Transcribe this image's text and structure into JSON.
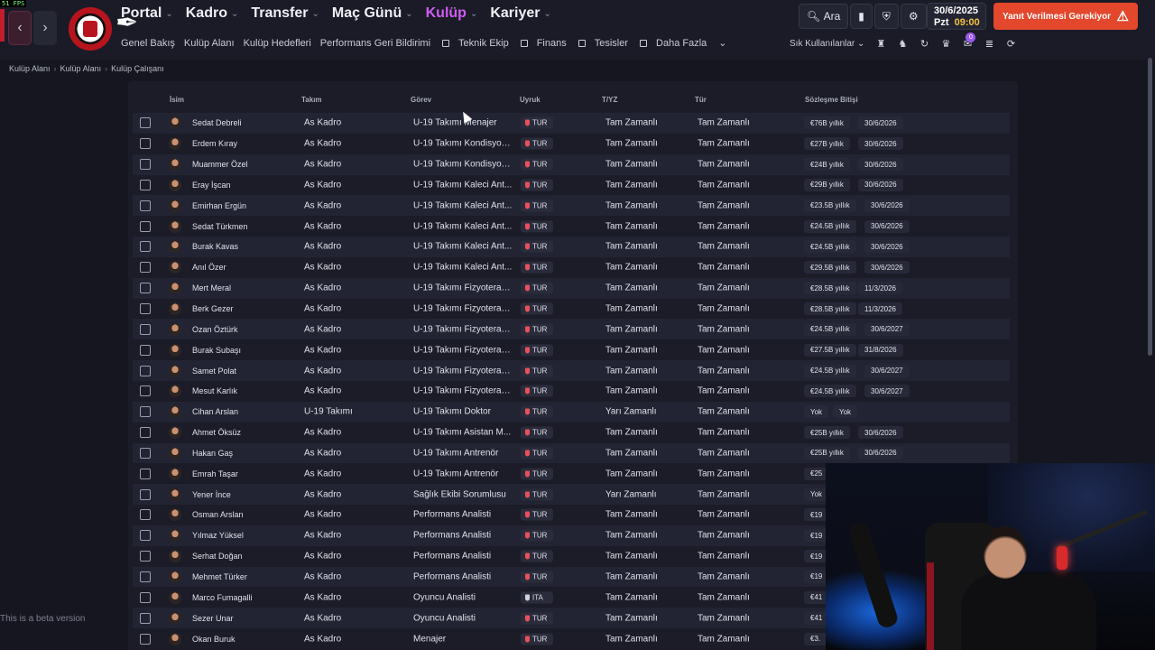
{
  "fps": "51 FPS",
  "nav": {
    "back": "‹",
    "forward": "›"
  },
  "menu": [
    {
      "label": "Portal"
    },
    {
      "label": "Kadro"
    },
    {
      "label": "Transfer"
    },
    {
      "label": "Maç Günü"
    },
    {
      "label": "Kulüp"
    },
    {
      "label": "Kariyer"
    }
  ],
  "submenu": [
    "Genel Bakış",
    "Kulüp Alanı",
    "Kulüp Hedefleri",
    "Performans Geri Bildirimi",
    "Teknik Ekip",
    "Finans",
    "Tesisler",
    "Daha Fazla"
  ],
  "search_label": "Ara",
  "date": "30/6/2025",
  "day": "Pzt",
  "time": "09:00",
  "alert_label": "Yanıt Verilmesi Gerekiyor",
  "shortcuts_label": "Sık Kullanılanlar",
  "notification_count": "0",
  "breadcrumb": [
    "Kulüp Alanı",
    "Kulüp Alanı",
    "Kulüp Çalışanı"
  ],
  "columns": [
    "İsim",
    "Takım",
    "Görev",
    "Uyruk",
    "T/YZ",
    "Tür",
    "Sözleşme Bitişi"
  ],
  "rows": [
    {
      "name": "Sedat Debreli",
      "team": "As Kadro",
      "role": "U-19 Takımı Menajer",
      "nat": "TUR",
      "ft": "Tam Zamanlı",
      "type": "Tam Zamanlı",
      "salary": "€76B yıllık",
      "end": "30/6/2026"
    },
    {
      "name": "Erdem Kıray",
      "team": "As Kadro",
      "role": "U-19 Takımı Kondisyon...",
      "nat": "TUR",
      "ft": "Tam Zamanlı",
      "type": "Tam Zamanlı",
      "salary": "€27B yıllık",
      "end": "30/6/2026"
    },
    {
      "name": "Muammer Özel",
      "team": "As Kadro",
      "role": "U-19 Takımı Kondisyon...",
      "nat": "TUR",
      "ft": "Tam Zamanlı",
      "type": "Tam Zamanlı",
      "salary": "€24B yıllık",
      "end": "30/6/2026"
    },
    {
      "name": "Eray İşcan",
      "team": "As Kadro",
      "role": "U-19 Takımı Kaleci Ant...",
      "nat": "TUR",
      "ft": "Tam Zamanlı",
      "type": "Tam Zamanlı",
      "salary": "€29B yıllık",
      "end": "30/6/2026"
    },
    {
      "name": "Emirhan Ergün",
      "team": "As Kadro",
      "role": "U-19 Takımı Kaleci Ant...",
      "nat": "TUR",
      "ft": "Tam Zamanlı",
      "type": "Tam Zamanlı",
      "salary": "€23.5B yıllık",
      "end": "30/6/2026"
    },
    {
      "name": "Sedat Türkmen",
      "team": "As Kadro",
      "role": "U-19 Takımı Kaleci Ant...",
      "nat": "TUR",
      "ft": "Tam Zamanlı",
      "type": "Tam Zamanlı",
      "salary": "€24.5B yıllık",
      "end": "30/6/2026"
    },
    {
      "name": "Burak Kavas",
      "team": "As Kadro",
      "role": "U-19 Takımı Kaleci Ant...",
      "nat": "TUR",
      "ft": "Tam Zamanlı",
      "type": "Tam Zamanlı",
      "salary": "€24.5B yıllık",
      "end": "30/6/2026"
    },
    {
      "name": "Anıl Özer",
      "team": "As Kadro",
      "role": "U-19 Takımı Kaleci Ant...",
      "nat": "TUR",
      "ft": "Tam Zamanlı",
      "type": "Tam Zamanlı",
      "salary": "€29.5B yıllık",
      "end": "30/6/2026"
    },
    {
      "name": "Mert Meral",
      "team": "As Kadro",
      "role": "U-19 Takımı Fizyoterap...",
      "nat": "TUR",
      "ft": "Tam Zamanlı",
      "type": "Tam Zamanlı",
      "salary": "€28.5B yıllık",
      "end": "11/3/2026"
    },
    {
      "name": "Berk Gezer",
      "team": "As Kadro",
      "role": "U-19 Takımı Fizyoterap...",
      "nat": "TUR",
      "ft": "Tam Zamanlı",
      "type": "Tam Zamanlı",
      "salary": "€28.5B yıllık",
      "end": "11/3/2026"
    },
    {
      "name": "Ozan Öztürk",
      "team": "As Kadro",
      "role": "U-19 Takımı Fizyoterap...",
      "nat": "TUR",
      "ft": "Tam Zamanlı",
      "type": "Tam Zamanlı",
      "salary": "€24.5B yıllık",
      "end": "30/6/2027"
    },
    {
      "name": "Burak Subaşı",
      "team": "As Kadro",
      "role": "U-19 Takımı Fizyoterap...",
      "nat": "TUR",
      "ft": "Tam Zamanlı",
      "type": "Tam Zamanlı",
      "salary": "€27.5B yıllık",
      "end": "31/8/2026"
    },
    {
      "name": "Samet Polat",
      "team": "As Kadro",
      "role": "U-19 Takımı Fizyoterap...",
      "nat": "TUR",
      "ft": "Tam Zamanlı",
      "type": "Tam Zamanlı",
      "salary": "€24.5B yıllık",
      "end": "30/6/2027"
    },
    {
      "name": "Mesut Karlık",
      "team": "As Kadro",
      "role": "U-19 Takımı Fizyoterap...",
      "nat": "TUR",
      "ft": "Tam Zamanlı",
      "type": "Tam Zamanlı",
      "salary": "€24.5B yıllık",
      "end": "30/6/2027"
    },
    {
      "name": "Cihan Arslan",
      "team": "U-19 Takımı",
      "role": "U-19 Takımı Doktor",
      "nat": "TUR",
      "ft": "Yarı Zamanlı",
      "type": "Tam Zamanlı",
      "salary": "Yok",
      "end": "Yok"
    },
    {
      "name": "Ahmet Öksüz",
      "team": "As Kadro",
      "role": "U-19 Takımı Asistan M...",
      "nat": "TUR",
      "ft": "Tam Zamanlı",
      "type": "Tam Zamanlı",
      "salary": "€25B yıllık",
      "end": "30/6/2026"
    },
    {
      "name": "Hakan Gaş",
      "team": "As Kadro",
      "role": "U-19 Takımı Antrenör",
      "nat": "TUR",
      "ft": "Tam Zamanlı",
      "type": "Tam Zamanlı",
      "salary": "€25B yıllık",
      "end": "30/6/2026"
    },
    {
      "name": "Emrah Taşar",
      "team": "As Kadro",
      "role": "U-19 Takımı Antrenör",
      "nat": "TUR",
      "ft": "Tam Zamanlı",
      "type": "Tam Zamanlı",
      "salary": "€25",
      "end": ""
    },
    {
      "name": "Yener İnce",
      "team": "As Kadro",
      "role": "Sağlık Ekibi Sorumlusu",
      "nat": "TUR",
      "ft": "Yarı Zamanlı",
      "type": "Tam Zamanlı",
      "salary": "Yok",
      "end": ""
    },
    {
      "name": "Osman Arslan",
      "team": "As Kadro",
      "role": "Performans Analisti",
      "nat": "TUR",
      "ft": "Tam Zamanlı",
      "type": "Tam Zamanlı",
      "salary": "€19",
      "end": ""
    },
    {
      "name": "Yılmaz Yüksel",
      "team": "As Kadro",
      "role": "Performans Analisti",
      "nat": "TUR",
      "ft": "Tam Zamanlı",
      "type": "Tam Zamanlı",
      "salary": "€19",
      "end": ""
    },
    {
      "name": "Serhat Doğan",
      "team": "As Kadro",
      "role": "Performans Analisti",
      "nat": "TUR",
      "ft": "Tam Zamanlı",
      "type": "Tam Zamanlı",
      "salary": "€19",
      "end": ""
    },
    {
      "name": "Mehmet Türker",
      "team": "As Kadro",
      "role": "Performans Analisti",
      "nat": "TUR",
      "ft": "Tam Zamanlı",
      "type": "Tam Zamanlı",
      "salary": "€19",
      "end": ""
    },
    {
      "name": "Marco Fumagalli",
      "team": "As Kadro",
      "role": "Oyuncu Analisti",
      "nat": "ITA",
      "ft": "Tam Zamanlı",
      "type": "Tam Zamanlı",
      "salary": "€41",
      "end": ""
    },
    {
      "name": "Sezer Unar",
      "team": "As Kadro",
      "role": "Oyuncu Analisti",
      "nat": "TUR",
      "ft": "Tam Zamanlı",
      "type": "Tam Zamanlı",
      "salary": "€41",
      "end": ""
    },
    {
      "name": "Okan Buruk",
      "team": "As Kadro",
      "role": "Menajer",
      "nat": "TUR",
      "ft": "Tam Zamanlı",
      "type": "Tam Zamanlı",
      "salary": "€3.",
      "end": ""
    }
  ],
  "beta_text": "This is a beta version"
}
